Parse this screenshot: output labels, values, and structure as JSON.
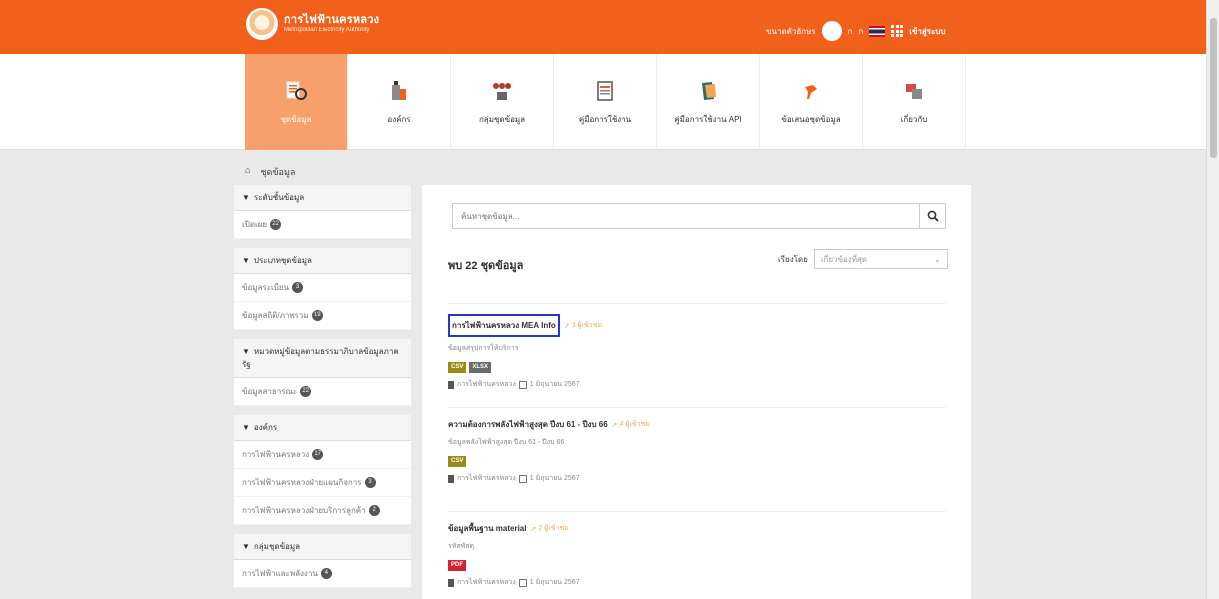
{
  "header": {
    "logo_title": "การไฟฟ้านครหลวง",
    "logo_subtitle": "Metropolitan Electricity Authority",
    "font_size_label": "ขนาดตัวอักษร",
    "font_a_minus": "ก",
    "font_a_plus": "ก",
    "login_label": "เข้าสู่ระบบ"
  },
  "nav": {
    "items": [
      {
        "label": "ชุดข้อมูล",
        "icon": "dataset-icon",
        "active": true
      },
      {
        "label": "องค์กร",
        "icon": "organization-icon"
      },
      {
        "label": "กลุ่มชุดข้อมูล",
        "icon": "group-icon"
      },
      {
        "label": "คู่มือการใช้งาน",
        "icon": "manual-icon"
      },
      {
        "label": "คู่มือการใช้งาน API",
        "icon": "api-manual-icon"
      },
      {
        "label": "ข้อเสนอชุดข้อมูล",
        "icon": "suggest-icon"
      },
      {
        "label": "เกี่ยวกับ",
        "icon": "about-icon"
      }
    ]
  },
  "breadcrumb": {
    "home_icon": "home-icon",
    "current": "ชุดข้อมูล"
  },
  "sidebar": {
    "groups": [
      {
        "title": "ระดับชั้นข้อมูล",
        "items": [
          {
            "label": "เปิดเผย",
            "count": "22"
          }
        ]
      },
      {
        "title": "ประเภทชุดข้อมูล",
        "items": [
          {
            "label": "ข้อมูลระเบียน",
            "count": "3"
          },
          {
            "label": "ข้อมูลสถิติ/ภาพรวม",
            "count": "19"
          }
        ]
      },
      {
        "title": "หมวดหมู่ข้อมูลตามธรรมาภิบาลข้อมูลภาครัฐ",
        "items": [
          {
            "label": "ข้อมูลสาธารณะ",
            "count": "22"
          }
        ]
      },
      {
        "title": "องค์กร",
        "items": [
          {
            "label": "การไฟฟ้านครหลวง",
            "count": "17"
          },
          {
            "label": "การไฟฟ้านครหลวงฝ่ายแผนกิจการ",
            "count": "3"
          },
          {
            "label": "การไฟฟ้านครหลวงฝ่ายบริการลูกค้า",
            "count": "2"
          }
        ]
      },
      {
        "title": "กลุ่มชุดข้อมูล",
        "items": [
          {
            "label": "การไฟฟ้าและพลังงาน",
            "count": "4"
          }
        ]
      }
    ]
  },
  "main": {
    "search_placeholder": "ค้นหาชุดข้อมูล...",
    "result_count": "พบ 22 ชุดข้อมูล",
    "sort_label": "เรียงโดย",
    "sort_value": "เกี่ยวข้องที่สุด",
    "datasets": [
      {
        "title": "การไฟฟ้านครหลวง MEA Info",
        "views": "3 ผู้เข้าชม",
        "subtitle": "ข้อมูลสรุปการให้บริการ",
        "tags": [
          {
            "text": "CSV",
            "color": "gold"
          },
          {
            "text": "XLSX",
            "color": "gray"
          }
        ],
        "org": "การไฟฟ้านครหลวง",
        "date": "1 มิถุนายน 2567",
        "highlight": true
      },
      {
        "title": "ความต้องการพลังไฟฟ้าสูงสุด ปีงบ 61 - ปีงบ 66",
        "views": "4 ผู้เข้าชม",
        "subtitle": "ข้อมูลพลังไฟฟ้าสูงสุด ปีงบ 61 - ปีงบ 66",
        "tags": [
          {
            "text": "CSV",
            "color": "gold"
          }
        ],
        "org": "การไฟฟ้านครหลวง",
        "date": "1 มิถุนายน 2567"
      },
      {
        "title": "ข้อมูลพื้นฐาน material",
        "views": "2 ผู้เข้าชม",
        "subtitle": "รหัสพัสดุ",
        "tags": [
          {
            "text": "PDF",
            "color": "red"
          }
        ],
        "org": "การไฟฟ้านครหลวง",
        "date": "1 มิถุนายน 2567"
      }
    ]
  },
  "colors": {
    "brand_orange": "#f2611b",
    "active_nav": "#f7a06c",
    "highlight_box": "#2a36c8"
  }
}
